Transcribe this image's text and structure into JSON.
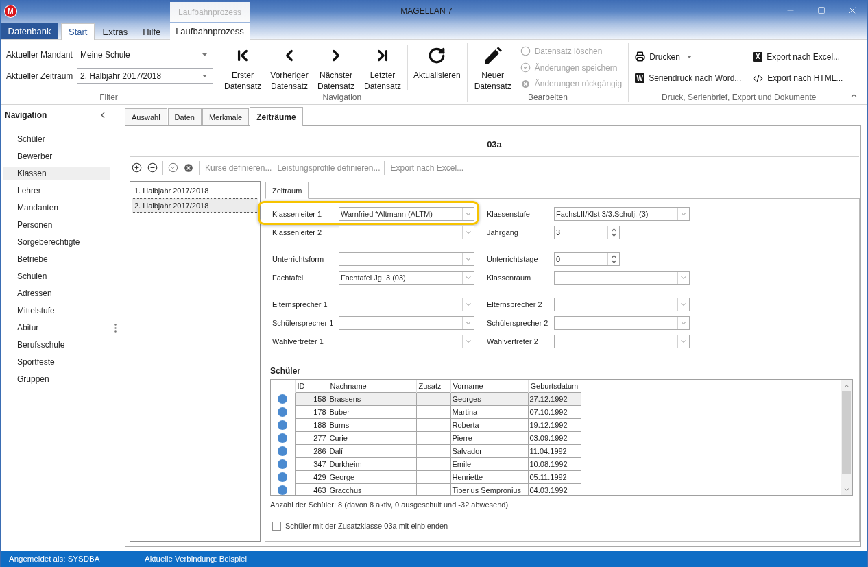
{
  "window": {
    "logo": "M",
    "title": "MAGELLAN 7"
  },
  "ribbon": {
    "contextual_group": "Laufbahnprozess",
    "tabs": [
      {
        "label": "Datenbank",
        "kind": "backstage",
        "selected": false
      },
      {
        "label": "Start",
        "kind": "tab",
        "selected": true
      },
      {
        "label": "Extras",
        "kind": "tab",
        "selected": false
      },
      {
        "label": "Hilfe",
        "kind": "tab",
        "selected": false
      },
      {
        "label": "Laufbahnprozess",
        "kind": "contextual",
        "selected": false
      }
    ],
    "groups": [
      {
        "label": "Filter",
        "kind": "filter",
        "fields": [
          {
            "label": "Aktueller Mandant",
            "value": "Meine Schule"
          },
          {
            "label": "Aktueller Zeitraum",
            "value": "2. Halbjahr 2017/2018"
          }
        ]
      },
      {
        "label": "Navigation",
        "kind": "commands",
        "sections": [
          {
            "items": [
              {
                "kind": "large",
                "label": "Erster Datensatz",
                "disabled": false
              },
              {
                "kind": "large",
                "label": "Vorheriger Datensatz",
                "disabled": false
              },
              {
                "kind": "large",
                "label": "Nächster Datensatz",
                "disabled": false
              },
              {
                "kind": "large",
                "label": "Letzter Datensatz",
                "disabled": false
              }
            ]
          },
          {
            "items": [
              {
                "kind": "large",
                "label": "Aktualisieren",
                "disabled": false
              }
            ]
          }
        ]
      },
      {
        "label": "Bearbeiten",
        "kind": "commands",
        "sections": [
          {
            "items": [
              {
                "kind": "large",
                "label": "Neuer Datensatz",
                "disabled": false
              },
              {
                "kind": "small",
                "label": "Datensatz löschen",
                "disabled": true,
                "dropdown": false
              },
              {
                "kind": "small",
                "label": "Änderungen speichern",
                "disabled": true,
                "dropdown": false
              },
              {
                "kind": "small",
                "label": "Änderungen rückgängig",
                "disabled": true,
                "dropdown": false
              }
            ]
          }
        ]
      },
      {
        "label": "Druck, Serienbrief, Export und Dokumente",
        "kind": "commands",
        "sections": [
          {
            "items": [
              {
                "kind": "small",
                "label": "Drucken",
                "disabled": false,
                "dropdown": true
              },
              {
                "kind": "small",
                "label": "Seriendruck nach Word...",
                "disabled": false,
                "dropdown": false,
                "icon_letter": "W"
              }
            ]
          },
          {
            "items": [
              {
                "kind": "small",
                "label": "Export nach Excel...",
                "disabled": false,
                "dropdown": false,
                "icon_letter": "X"
              },
              {
                "kind": "small",
                "label": "Export nach HTML...",
                "disabled": false,
                "dropdown": false
              }
            ]
          }
        ]
      }
    ]
  },
  "navigation": {
    "title": "Navigation",
    "items": [
      {
        "label": "Schüler",
        "selected": false
      },
      {
        "label": "Bewerber",
        "selected": false
      },
      {
        "label": "Klassen",
        "selected": true
      },
      {
        "label": "Lehrer",
        "selected": false
      },
      {
        "label": "Mandanten",
        "selected": false
      },
      {
        "label": "Personen",
        "selected": false
      },
      {
        "label": "Sorgeberechtigte",
        "selected": false
      },
      {
        "label": "Betriebe",
        "selected": false
      },
      {
        "label": "Schulen",
        "selected": false
      },
      {
        "label": "Adressen",
        "selected": false
      },
      {
        "label": "Mittelstufe",
        "selected": false
      },
      {
        "label": "Abitur",
        "selected": false
      },
      {
        "label": "Berufsschule",
        "selected": false
      },
      {
        "label": "Sportfeste",
        "selected": false
      },
      {
        "label": "Gruppen",
        "selected": false
      }
    ]
  },
  "content": {
    "tabs": [
      {
        "label": "Auswahl",
        "selected": false
      },
      {
        "label": "Daten",
        "selected": false
      },
      {
        "label": "Merkmale",
        "selected": false
      },
      {
        "label": "Zeiträume",
        "selected": true
      }
    ],
    "record_title": "03a",
    "toolbar": {
      "groups": [
        {
          "actions": [
            {
              "label": "Kurse definieren...",
              "disabled": true
            },
            {
              "label": "Leistungsprofile definieren...",
              "disabled": true
            }
          ]
        },
        {
          "actions": [
            {
              "label": "Export nach Excel...",
              "disabled": true
            }
          ]
        }
      ]
    },
    "periods": [
      {
        "label": "1. Halbjahr 2017/2018",
        "selected": false
      },
      {
        "label": "2. Halbjahr 2017/2018",
        "selected": true
      }
    ],
    "detail_tabs": [
      {
        "label": "Zeitraum",
        "selected": true
      }
    ],
    "form": {
      "groups": [
        {
          "rows": [
            {
              "left": {
                "label": "Klassenleiter 1",
                "kind": "combo",
                "value": "Warnfried *Altmann (ALTM)",
                "highlighted": true
              },
              "right": {
                "label": "Klassenstufe",
                "kind": "combo",
                "value": "Fachst.II/Klst 3/3.Schulj. (3)",
                "highlighted": false
              }
            },
            {
              "left": {
                "label": "Klassenleiter 2",
                "kind": "combo",
                "highlighted": false
              },
              "right": {
                "label": "Jahrgang",
                "kind": "spinner",
                "value": "3",
                "highlighted": false
              }
            }
          ]
        },
        {
          "rows": [
            {
              "left": {
                "label": "Unterrichtsform",
                "kind": "combo",
                "highlighted": false
              },
              "right": {
                "label": "Unterrichtstage",
                "kind": "spinner",
                "value": "0",
                "highlighted": false
              }
            },
            {
              "left": {
                "label": "Fachtafel",
                "kind": "combo",
                "value": "Fachtafel Jg. 3 (03)",
                "highlighted": false
              },
              "right": {
                "label": "Klassenraum",
                "kind": "combo",
                "highlighted": false
              }
            }
          ]
        },
        {
          "rows": [
            {
              "left": {
                "label": "Elternsprecher 1",
                "kind": "combo",
                "highlighted": false
              },
              "right": {
                "label": "Elternsprecher 2",
                "kind": "combo",
                "highlighted": false
              }
            },
            {
              "left": {
                "label": "Schülersprecher 1",
                "kind": "combo",
                "highlighted": false
              },
              "right": {
                "label": "Schülersprecher 2",
                "kind": "combo",
                "highlighted": false
              }
            },
            {
              "left": {
                "label": "Wahlvertreter 1",
                "kind": "combo",
                "highlighted": false
              },
              "right": {
                "label": "Wahlvertreter 2",
                "kind": "combo",
                "highlighted": false
              }
            }
          ]
        }
      ]
    },
    "students": {
      "title": "Schüler",
      "columns": [
        "ID",
        "Nachname",
        "Zusatz",
        "Vorname",
        "Geburtsdatum"
      ],
      "rows": [
        {
          "id": "158",
          "last_name": "Brassens",
          "first_name": "Georges",
          "birth_date": "27.12.1992",
          "color": "#4a8ad0",
          "selected": true
        },
        {
          "id": "178",
          "last_name": "Buber",
          "first_name": "Martina",
          "birth_date": "07.10.1992",
          "color": "#4a8ad0",
          "selected": false
        },
        {
          "id": "188",
          "last_name": "Burns",
          "first_name": "Roberta",
          "birth_date": "19.12.1992",
          "color": "#4a8ad0",
          "selected": false
        },
        {
          "id": "277",
          "last_name": "Curie",
          "first_name": "Pierre",
          "birth_date": "03.09.1992",
          "color": "#4a8ad0",
          "selected": false
        },
        {
          "id": "286",
          "last_name": "Dalí",
          "first_name": "Salvador",
          "birth_date": "11.04.1992",
          "color": "#4a8ad0",
          "selected": false
        },
        {
          "id": "347",
          "last_name": "Durkheim",
          "first_name": "Emile",
          "birth_date": "10.08.1992",
          "color": "#4a8ad0",
          "selected": false
        },
        {
          "id": "429",
          "last_name": "George",
          "first_name": "Henriette",
          "birth_date": "05.11.1992",
          "color": "#4a8ad0",
          "selected": false
        },
        {
          "id": "463",
          "last_name": "Gracchus",
          "first_name": "Tiberius Sempronius",
          "birth_date": "04.03.1992",
          "color": "#4a8ad0",
          "selected": false
        }
      ],
      "summary": "Anzahl der Schüler: 8 (davon 8 aktiv, 0 ausgeschult und -32 abwesend)",
      "option": {
        "label": "Schüler mit der Zusatzklasse 03a mit einblenden",
        "checked": false
      }
    }
  },
  "status_bar": {
    "items": [
      "Angemeldet als: SYSDBA",
      "Aktuelle Verbindung: Beispiel"
    ]
  }
}
